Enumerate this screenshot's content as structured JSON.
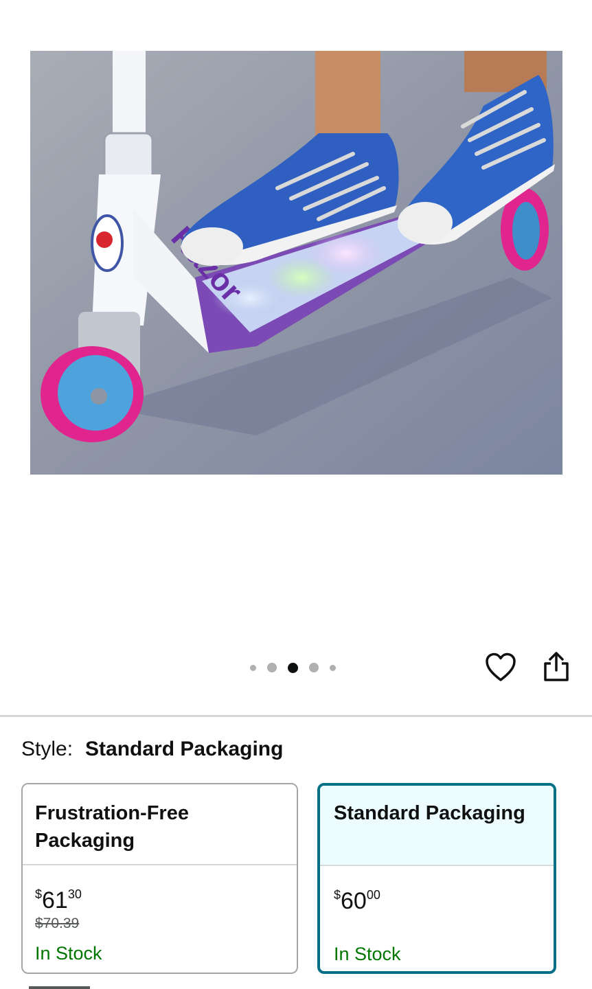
{
  "product": {
    "image_alt": "Child's blue sneakers on a purple Razor kick scooter with light-up deck",
    "image_brand_text": "Razor"
  },
  "gallery": {
    "dot_count": 5,
    "active_dot_index": 2
  },
  "actions": {
    "wishlist_icon": "heart-outline-icon",
    "share_icon": "share-icon"
  },
  "style": {
    "label": "Style:",
    "selected_value": "Standard Packaging"
  },
  "options": [
    {
      "title": "Frustration-Free Packaging",
      "currency": "$",
      "price_whole": "61",
      "price_fraction": "30",
      "list_price": "$70.39",
      "availability": "In Stock",
      "selected": false
    },
    {
      "title": "Standard Packaging",
      "currency": "$",
      "price_whole": "60",
      "price_fraction": "00",
      "list_price": "",
      "availability": "In Stock",
      "selected": true
    }
  ],
  "colors": {
    "selected_border": "#007185",
    "selected_background": "#edfdff",
    "in_stock": "#007600",
    "active_dot": "#0f1111"
  }
}
